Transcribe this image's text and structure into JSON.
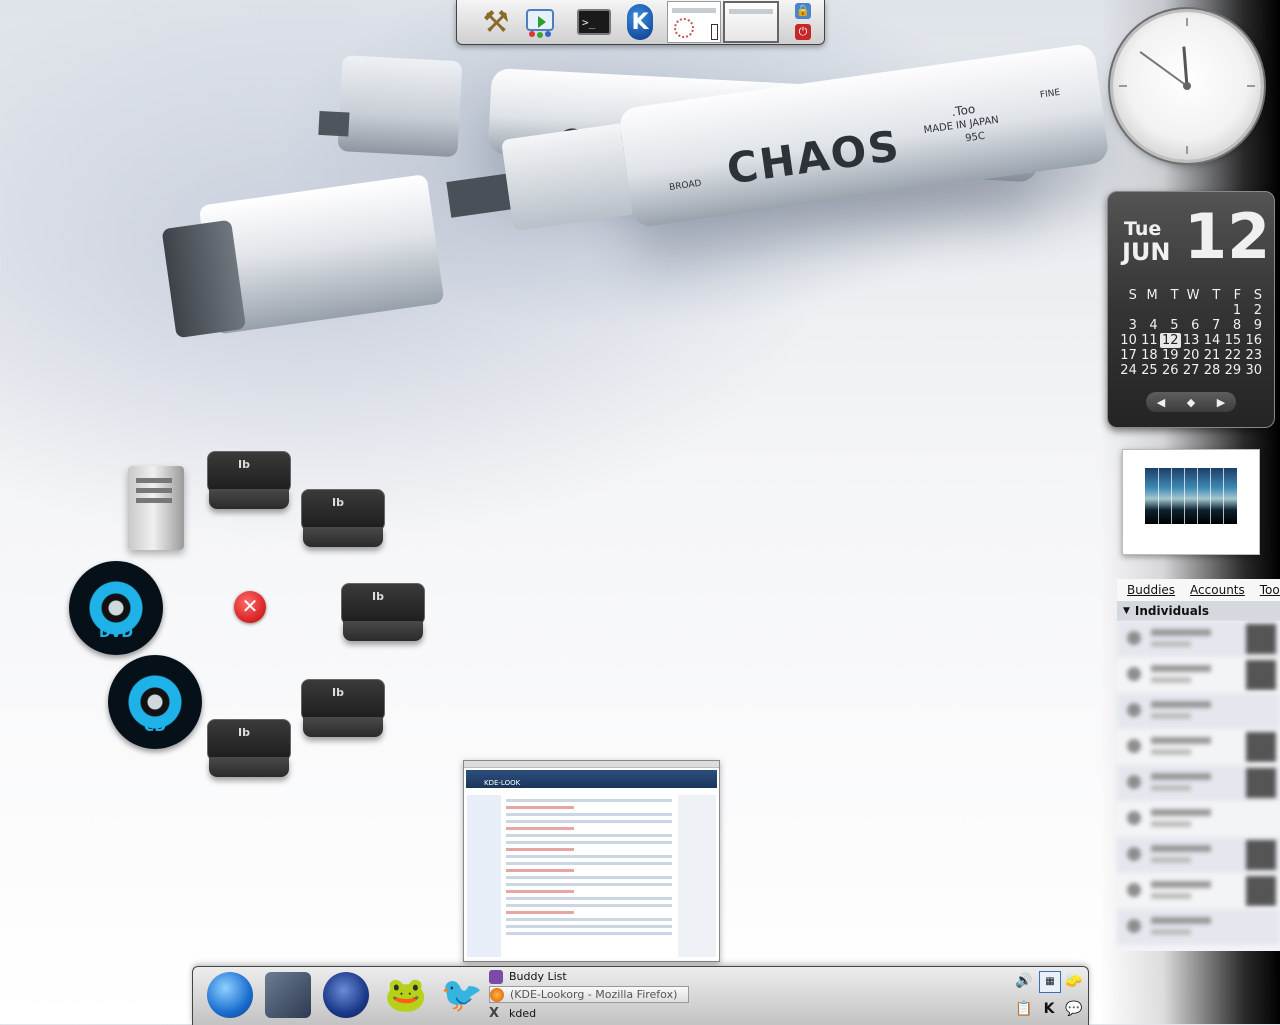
{
  "top_panel": {
    "launchers": [
      {
        "icon": "tools-icon"
      },
      {
        "icon": "software-update-icon"
      },
      {
        "icon": "terminal-icon",
        "text": ">_"
      },
      {
        "icon": "kde-menu-icon",
        "text": "K"
      }
    ],
    "pager": [
      {
        "active": false
      },
      {
        "active": true
      }
    ],
    "lock_icon": "lock-icon",
    "logout_icon": "power-icon"
  },
  "wallpaper": {
    "brand": "CHAOS",
    "marker_text_too": ".Too",
    "marker_text_origin": "MADE IN JAPAN",
    "marker_text_code": "95C",
    "marker_text_broad": "BROAD",
    "marker_text_fine": "FINE"
  },
  "clock": {
    "hour": 11,
    "minute": 51
  },
  "calendar": {
    "day_of_week": "Tue",
    "month": "JUN",
    "day": "12",
    "weekday_headers": [
      "S",
      "M",
      "T",
      "W",
      "T",
      "F",
      "S"
    ],
    "weeks": [
      [
        "",
        "",
        "",
        "",
        "",
        "1",
        "2"
      ],
      [
        "3",
        "4",
        "5",
        "6",
        "7",
        "8",
        "9"
      ],
      [
        "10",
        "11",
        "12",
        "13",
        "14",
        "15",
        "16"
      ],
      [
        "17",
        "18",
        "19",
        "20",
        "21",
        "22",
        "23"
      ],
      [
        "24",
        "25",
        "26",
        "27",
        "28",
        "29",
        "30"
      ]
    ],
    "today": "12",
    "nav": {
      "prev": "◀",
      "home": "◆",
      "next": "▶"
    }
  },
  "buddy_list": {
    "menu": [
      "Buddies",
      "Accounts",
      "Tools"
    ],
    "group": "Individuals",
    "rows": 9
  },
  "desktop_icons": [
    {
      "name": "computer-icon",
      "label": ""
    },
    {
      "name": "drive-icon",
      "label": "Ib"
    },
    {
      "name": "dvd-icon",
      "label": "DVD"
    },
    {
      "name": "cd-icon",
      "label": "CD"
    }
  ],
  "taskbar": {
    "tasks": [
      {
        "label": "Buddy List",
        "active": false,
        "icon": "pidgin-icon"
      },
      {
        "label": "(KDE-Lookorg - Mozilla Firefox)",
        "active": true,
        "icon": "firefox-icon"
      },
      {
        "label": "kded",
        "active": false,
        "icon": "x-icon"
      }
    ],
    "launchers": [
      "globe-icon",
      "mail-icon",
      "moon-icon",
      "frog-icon",
      "pidgin-icon"
    ]
  },
  "thumbnail": {
    "title": "KDE-LOOK"
  }
}
